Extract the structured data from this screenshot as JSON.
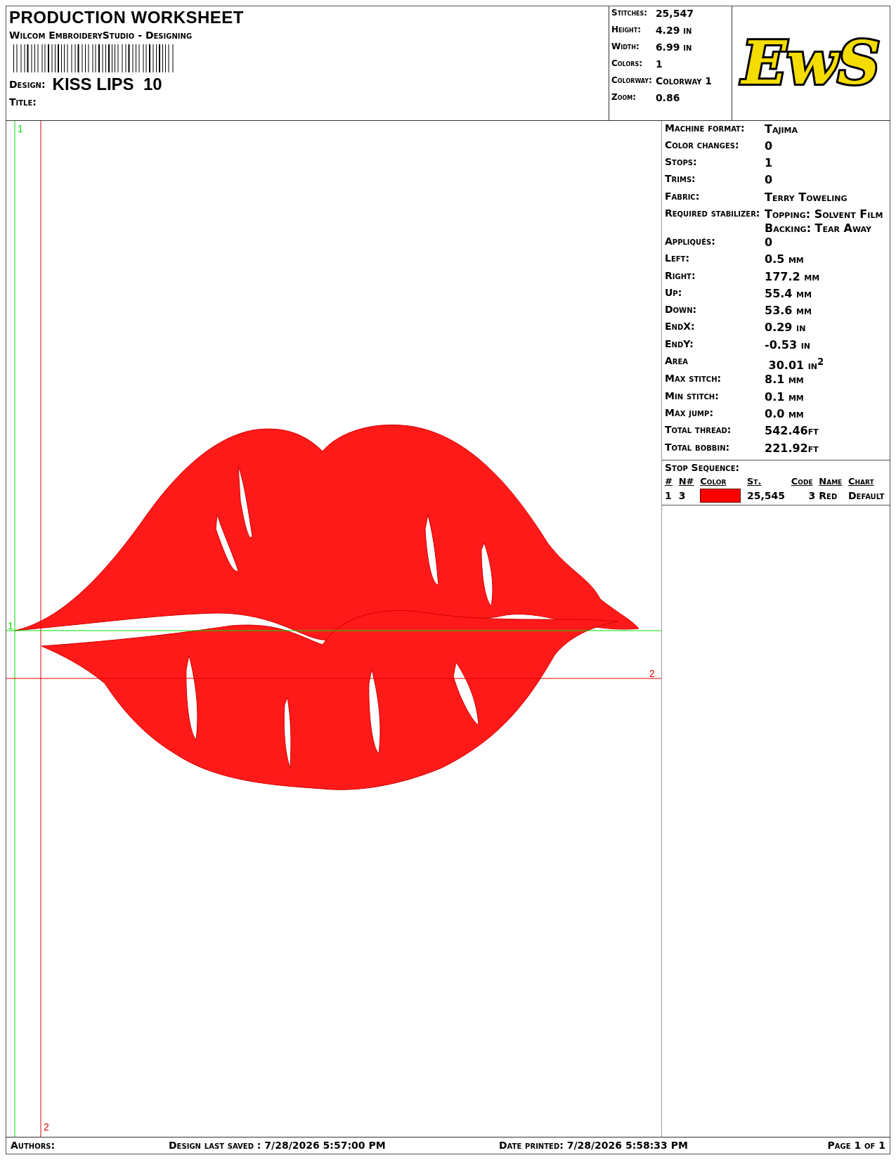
{
  "header": {
    "title": "PRODUCTION WORKSHEET",
    "subtitle": "Wilcom EmbroideryStudio - Designing",
    "design_label": "Design:",
    "design_name": "KISS LIPS  10",
    "title_label": "Title:"
  },
  "summary": [
    {
      "label": "Stitches:",
      "value": "25,547"
    },
    {
      "label": "Height:",
      "value": "4.29 in"
    },
    {
      "label": "Width:",
      "value": "6.99 in"
    },
    {
      "label": "Colors:",
      "value": "1"
    },
    {
      "label": "Colorway:",
      "value": "Colorway 1"
    },
    {
      "label": "Zoom:",
      "value": "0.86"
    }
  ],
  "logo": {
    "text": "EwS"
  },
  "vertical_guides": [
    {
      "label": "1",
      "color": "#00e000"
    },
    {
      "label": "2",
      "color": "#e00000"
    }
  ],
  "horizontal_guides": [
    {
      "label": "1",
      "color": "#00e000"
    },
    {
      "label": "2",
      "color": "#e00000"
    }
  ],
  "details": [
    {
      "label": "Machine format:",
      "values": [
        "Tajima"
      ]
    },
    {
      "label": "Color changes:",
      "values": [
        "0"
      ]
    },
    {
      "label": "Stops:",
      "values": [
        "1"
      ]
    },
    {
      "label": "Trims:",
      "values": [
        "0"
      ]
    },
    {
      "label": "Fabric:",
      "values": [
        "Terry Toweling"
      ]
    },
    {
      "label": "Required stabilizer:",
      "values": [
        "Topping: Solvent Film",
        "Backing: Tear Away"
      ]
    },
    {
      "label": "Appliqués:",
      "values": [
        "0"
      ]
    },
    {
      "label": "Left:",
      "values": [
        "0.5 mm"
      ]
    },
    {
      "label": "Right:",
      "values": [
        "177.2 mm"
      ]
    },
    {
      "label": "Up:",
      "values": [
        "55.4 mm"
      ]
    },
    {
      "label": "Down:",
      "values": [
        "53.6 mm"
      ]
    },
    {
      "label": "EndX:",
      "values": [
        "0.29 in"
      ]
    },
    {
      "label": "EndY:",
      "values": [
        "-0.53 in"
      ]
    },
    {
      "label": "Area",
      "values": [
        " 30.01 in$^{2}$"
      ]
    },
    {
      "label": "Max stitch:",
      "values": [
        "8.1 mm"
      ]
    },
    {
      "label": "Min stitch:",
      "values": [
        "0.1 mm"
      ]
    },
    {
      "label": "Max jump:",
      "values": [
        "0.0 mm"
      ]
    },
    {
      "label": "Total thread:",
      "values": [
        "542.46ft"
      ]
    },
    {
      "label": "Total bobbin:",
      "values": [
        "221.92ft"
      ]
    }
  ],
  "stop_sequence": {
    "title": "Stop Sequence:",
    "columns": [
      "#",
      "N#",
      "Color",
      "St.",
      "Code",
      "Name",
      "Chart"
    ],
    "rows": [
      {
        "index": "1",
        "needle": "3",
        "color": "#ff0000",
        "stitches": "25,545",
        "code": "3",
        "name": "Red",
        "chart": "Default"
      }
    ]
  },
  "footer": {
    "authors": "Authors:",
    "last_saved": "Design last saved : 7/28/2026 5:57:00 PM",
    "printed": "Date printed: 7/28/2026 5:58:33 PM",
    "page": "Page 1 of 1"
  }
}
